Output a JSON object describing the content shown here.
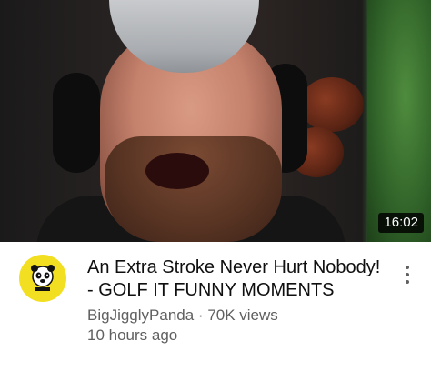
{
  "video": {
    "duration": "16:02",
    "title": "An Extra Stroke Never Hurt Nobody! - GOLF IT FUNNY MOMENTS",
    "channel": "BigJigglyPanda",
    "separator": " · ",
    "views": "70K views",
    "age": "10 hours ago"
  },
  "icons": {
    "avatar": "panda-logo-icon",
    "menu": "more-vert-icon"
  },
  "colors": {
    "avatar_bg": "#f2df22",
    "title": "#0f0f0f",
    "meta": "#606060"
  }
}
